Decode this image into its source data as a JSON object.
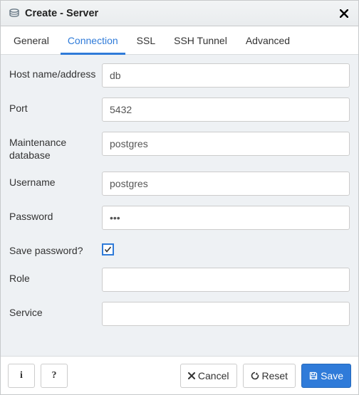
{
  "dialog": {
    "title": "Create - Server"
  },
  "tabs": {
    "general": "General",
    "connection": "Connection",
    "ssl": "SSL",
    "ssh": "SSH Tunnel",
    "advanced": "Advanced",
    "active": "connection"
  },
  "form": {
    "host": {
      "label": "Host name/address",
      "value": "db"
    },
    "port": {
      "label": "Port",
      "value": "5432"
    },
    "maintenance_db": {
      "label": "Maintenance database",
      "value": "postgres"
    },
    "username": {
      "label": "Username",
      "value": "postgres"
    },
    "password": {
      "label": "Password",
      "value": "•••",
      "raw": "***"
    },
    "save_password": {
      "label": "Save password?",
      "checked": true
    },
    "role": {
      "label": "Role",
      "value": ""
    },
    "service": {
      "label": "Service",
      "value": ""
    }
  },
  "footer": {
    "info": "i",
    "help": "?",
    "cancel": "Cancel",
    "reset": "Reset",
    "save": "Save"
  }
}
